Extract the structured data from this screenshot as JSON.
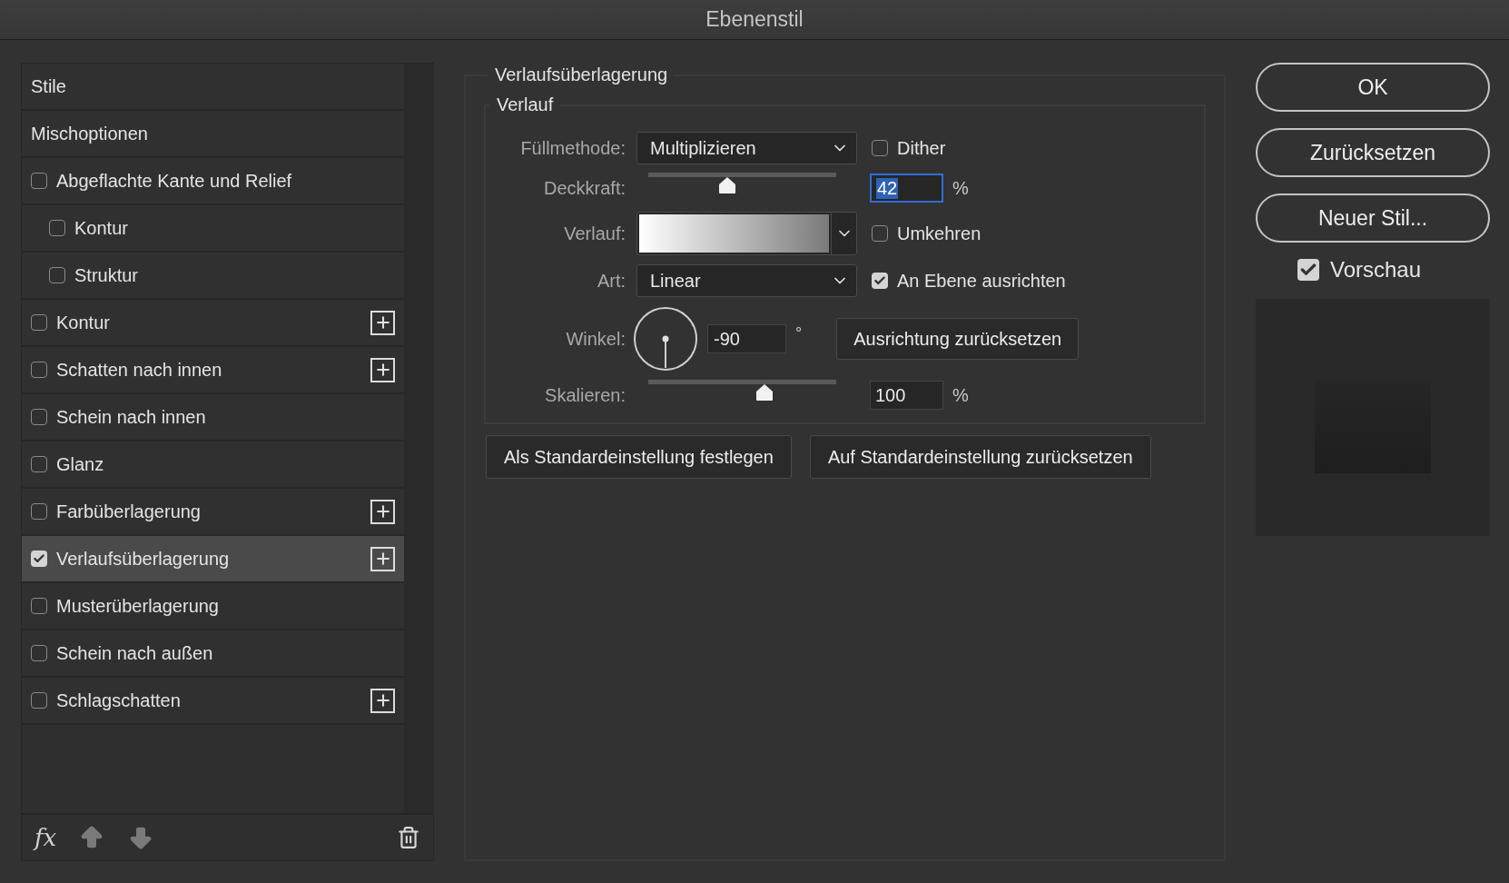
{
  "window": {
    "title": "Ebenenstil"
  },
  "styles": {
    "items": [
      {
        "kind": "header",
        "label": "Stile",
        "selected": false
      },
      {
        "kind": "header",
        "label": "Mischoptionen",
        "selected": false
      },
      {
        "kind": "checkbox",
        "label": "Abgeflachte Kante und Relief",
        "checked": false,
        "selected": false,
        "addable": false,
        "children": [
          {
            "kind": "checkbox",
            "label": "Kontur",
            "checked": false,
            "selected": false,
            "addable": false
          },
          {
            "kind": "checkbox",
            "label": "Struktur",
            "checked": false,
            "selected": false,
            "addable": false
          }
        ]
      },
      {
        "kind": "checkbox",
        "label": "Kontur",
        "checked": false,
        "selected": false,
        "addable": true
      },
      {
        "kind": "checkbox",
        "label": "Schatten nach innen",
        "checked": false,
        "selected": false,
        "addable": true
      },
      {
        "kind": "checkbox",
        "label": "Schein nach innen",
        "checked": false,
        "selected": false,
        "addable": false
      },
      {
        "kind": "checkbox",
        "label": "Glanz",
        "checked": false,
        "selected": false,
        "addable": false
      },
      {
        "kind": "checkbox",
        "label": "Farbüberlagerung",
        "checked": false,
        "selected": false,
        "addable": true
      },
      {
        "kind": "checkbox",
        "label": "Verlaufsüberlagerung",
        "checked": true,
        "selected": true,
        "addable": true
      },
      {
        "kind": "checkbox",
        "label": "Musterüberlagerung",
        "checked": false,
        "selected": false,
        "addable": false
      },
      {
        "kind": "checkbox",
        "label": "Schein nach außen",
        "checked": false,
        "selected": false,
        "addable": false
      },
      {
        "kind": "checkbox",
        "label": "Schlagschatten",
        "checked": false,
        "selected": false,
        "addable": true
      }
    ],
    "footer": {
      "fx_label": "fx"
    }
  },
  "gradient_overlay": {
    "title": "Verlaufsüberlagerung",
    "section_title": "Verlauf",
    "blend_mode": {
      "label": "Füllmethode:",
      "value": "Multiplizieren"
    },
    "dither": {
      "label": "Dither",
      "checked": false
    },
    "opacity": {
      "label": "Deckkraft:",
      "level": 0.42,
      "value": "42",
      "value_selected": true,
      "unit": "%"
    },
    "gradient": {
      "label": "Verlauf:"
    },
    "reverse": {
      "label": "Umkehren",
      "checked": false
    },
    "style": {
      "label": "Art:",
      "value": "Linear"
    },
    "align": {
      "label": "An Ebene ausrichten",
      "checked": true
    },
    "angle": {
      "label": "Winkel:",
      "value": "-90",
      "unit": "°"
    },
    "reset_alignment": "Ausrichtung zurücksetzen",
    "scale": {
      "label": "Skalieren:",
      "level": 0.62,
      "value": "100",
      "unit": "%"
    },
    "buttons": [
      "Als Standardeinstellung festlegen",
      "Auf Standardeinstellung zurücksetzen"
    ]
  },
  "actions": {
    "buttons": [
      "OK",
      "Zurücksetzen",
      "Neuer Stil..."
    ],
    "preview": {
      "label": "Vorschau",
      "checked": true
    }
  }
}
